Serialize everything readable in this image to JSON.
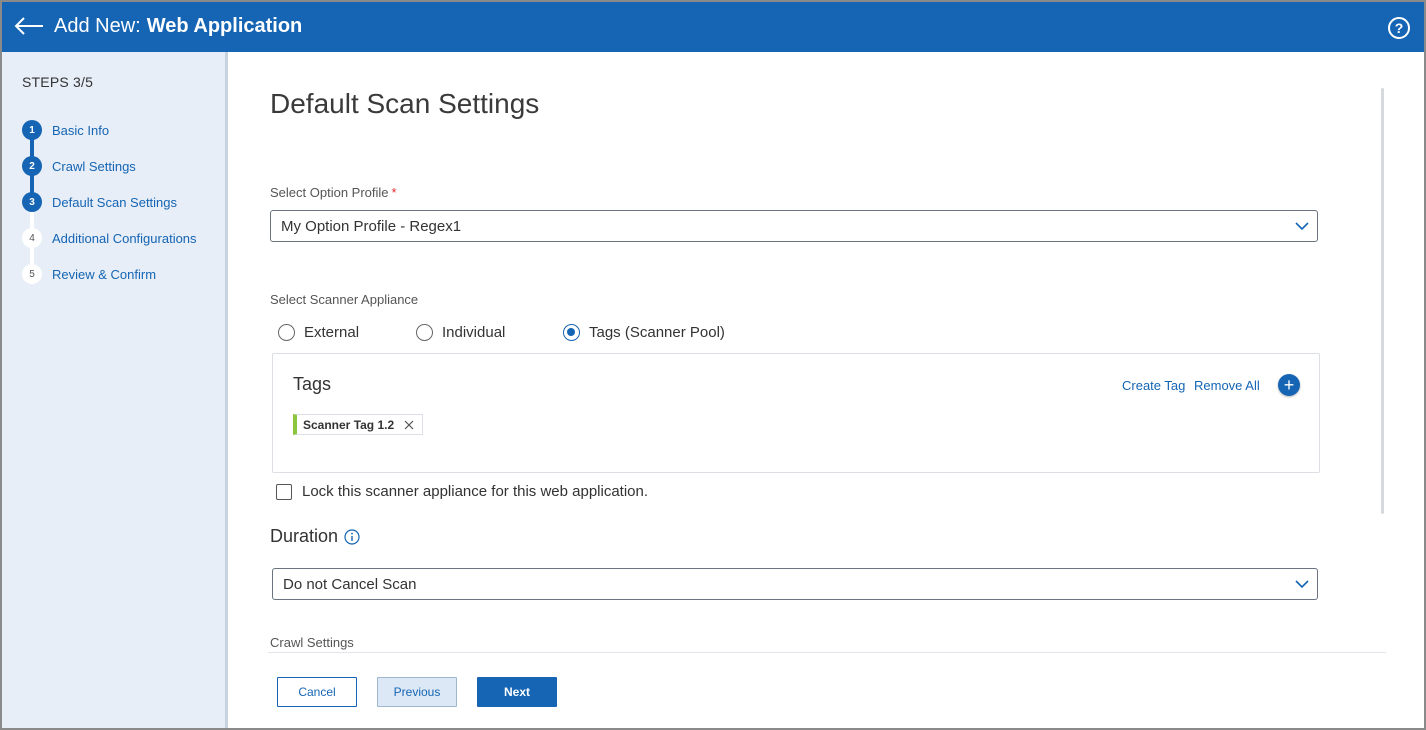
{
  "header": {
    "title_prefix": "Add New:",
    "title_name": "Web Application",
    "help_label": "?"
  },
  "sidebar": {
    "steps_title": "STEPS 3/5",
    "steps": [
      {
        "number": "1",
        "label": "Basic Info",
        "status": "done"
      },
      {
        "number": "2",
        "label": "Crawl Settings",
        "status": "done"
      },
      {
        "number": "3",
        "label": "Default Scan Settings",
        "status": "current"
      },
      {
        "number": "4",
        "label": "Additional Configurations",
        "status": "todo"
      },
      {
        "number": "5",
        "label": "Review & Confirm",
        "status": "todo"
      }
    ]
  },
  "main": {
    "page_title": "Default Scan Settings",
    "option_profile": {
      "label": "Select Option Profile",
      "required_marker": "*",
      "value": "My Option Profile - Regex1"
    },
    "scanner_appliance": {
      "label": "Select Scanner Appliance",
      "options": [
        {
          "label": "External",
          "checked": false
        },
        {
          "label": "Individual",
          "checked": false
        },
        {
          "label": "Tags (Scanner Pool)",
          "checked": true
        }
      ]
    },
    "tags": {
      "title": "Tags",
      "create_tag_label": "Create Tag",
      "remove_all_label": "Remove All",
      "add_label": "+",
      "items": [
        {
          "label": "Scanner Tag 1.2",
          "color": "#8cc63e"
        }
      ]
    },
    "lock_checkbox": {
      "label": "Lock this scanner appliance for this web application.",
      "checked": false
    },
    "duration": {
      "title": "Duration",
      "value": "Do not Cancel Scan"
    },
    "crawl_settings_label": "Crawl Settings"
  },
  "footer": {
    "cancel_label": "Cancel",
    "previous_label": "Previous",
    "next_label": "Next"
  },
  "colors": {
    "brand": "#1565b4",
    "sidebar_bg": "#e7eef7",
    "tag_accent": "#8cc63e",
    "required": "#e03030"
  }
}
